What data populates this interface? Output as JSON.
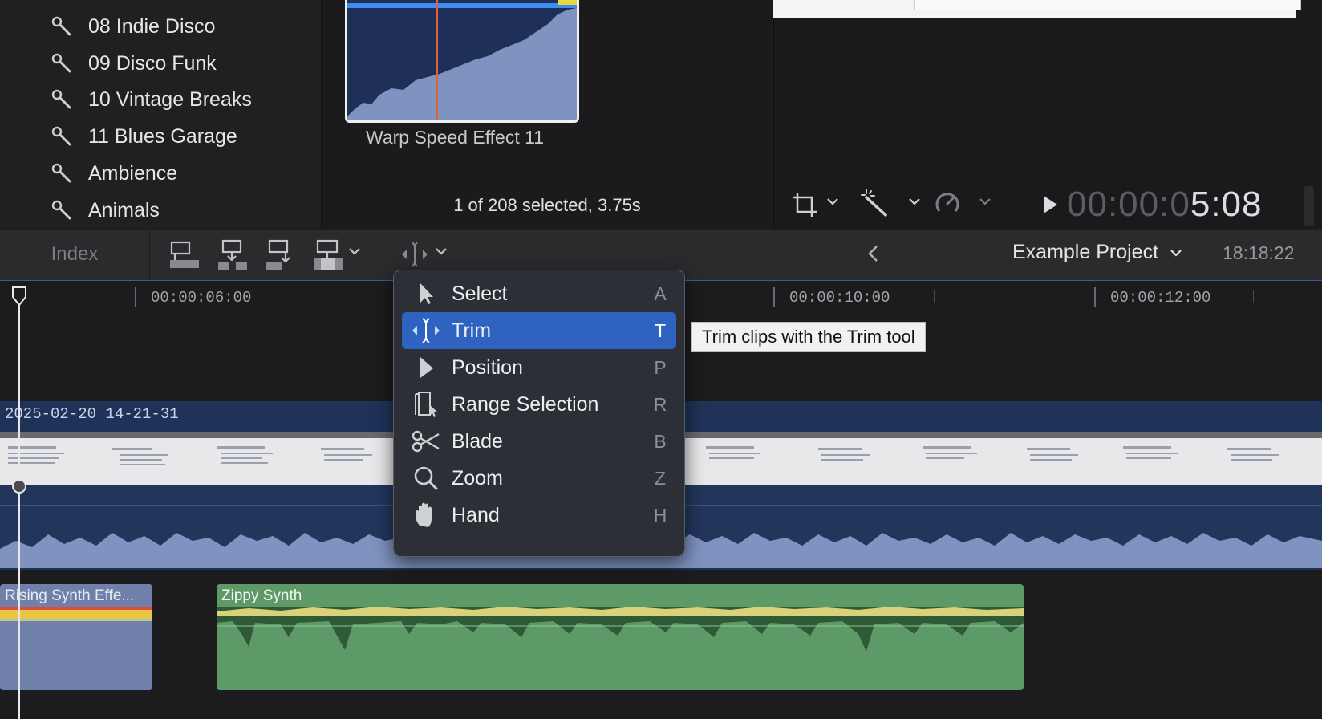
{
  "sidebar": {
    "items": [
      {
        "label": "08 Indie Disco",
        "icon": "wrench-icon"
      },
      {
        "label": "09 Disco Funk",
        "icon": "wrench-icon"
      },
      {
        "label": "10 Vintage Breaks",
        "icon": "wrench-icon"
      },
      {
        "label": "11 Blues Garage",
        "icon": "wrench-icon"
      },
      {
        "label": "Ambience",
        "icon": "wrench-icon"
      },
      {
        "label": "Animals",
        "icon": "wrench-icon"
      }
    ]
  },
  "browser": {
    "clip_name": "Warp Speed Effect 11",
    "selection_status": "1 of 208 selected, 3.75s"
  },
  "viewer": {
    "timecode_dim": "00:00:0",
    "timecode_lit": "5:08"
  },
  "toolbar": {
    "index_label": "Index",
    "project_title": "Example Project",
    "project_duration": "18:18:22"
  },
  "timeline": {
    "ruler": [
      "00:00:06:00",
      "00:00:10:00",
      "00:00:12:00"
    ],
    "video_clip_label": "2025-02-20 14-21-31",
    "audio_clips": [
      "Rising Synth Effe...",
      "Zippy Synth"
    ]
  },
  "tool_menu": {
    "items": [
      {
        "label": "Select",
        "key": "A",
        "icon": "arrow-pointer-icon",
        "active": false
      },
      {
        "label": "Trim",
        "key": "T",
        "icon": "trim-icon",
        "active": true
      },
      {
        "label": "Position",
        "key": "P",
        "icon": "position-arrow-icon",
        "active": false
      },
      {
        "label": "Range Selection",
        "key": "R",
        "icon": "range-selection-icon",
        "active": false
      },
      {
        "label": "Blade",
        "key": "B",
        "icon": "scissors-icon",
        "active": false
      },
      {
        "label": "Zoom",
        "key": "Z",
        "icon": "magnifier-icon",
        "active": false
      },
      {
        "label": "Hand",
        "key": "H",
        "icon": "hand-icon",
        "active": false
      }
    ],
    "tooltip": "Trim clips with the Trim tool"
  },
  "colors": {
    "menu_highlight": "#2f63c2",
    "video_clip": "#1f3358",
    "audio_clip_green": "#5e9a68",
    "audio_clip_blue": "#6f80aa"
  }
}
